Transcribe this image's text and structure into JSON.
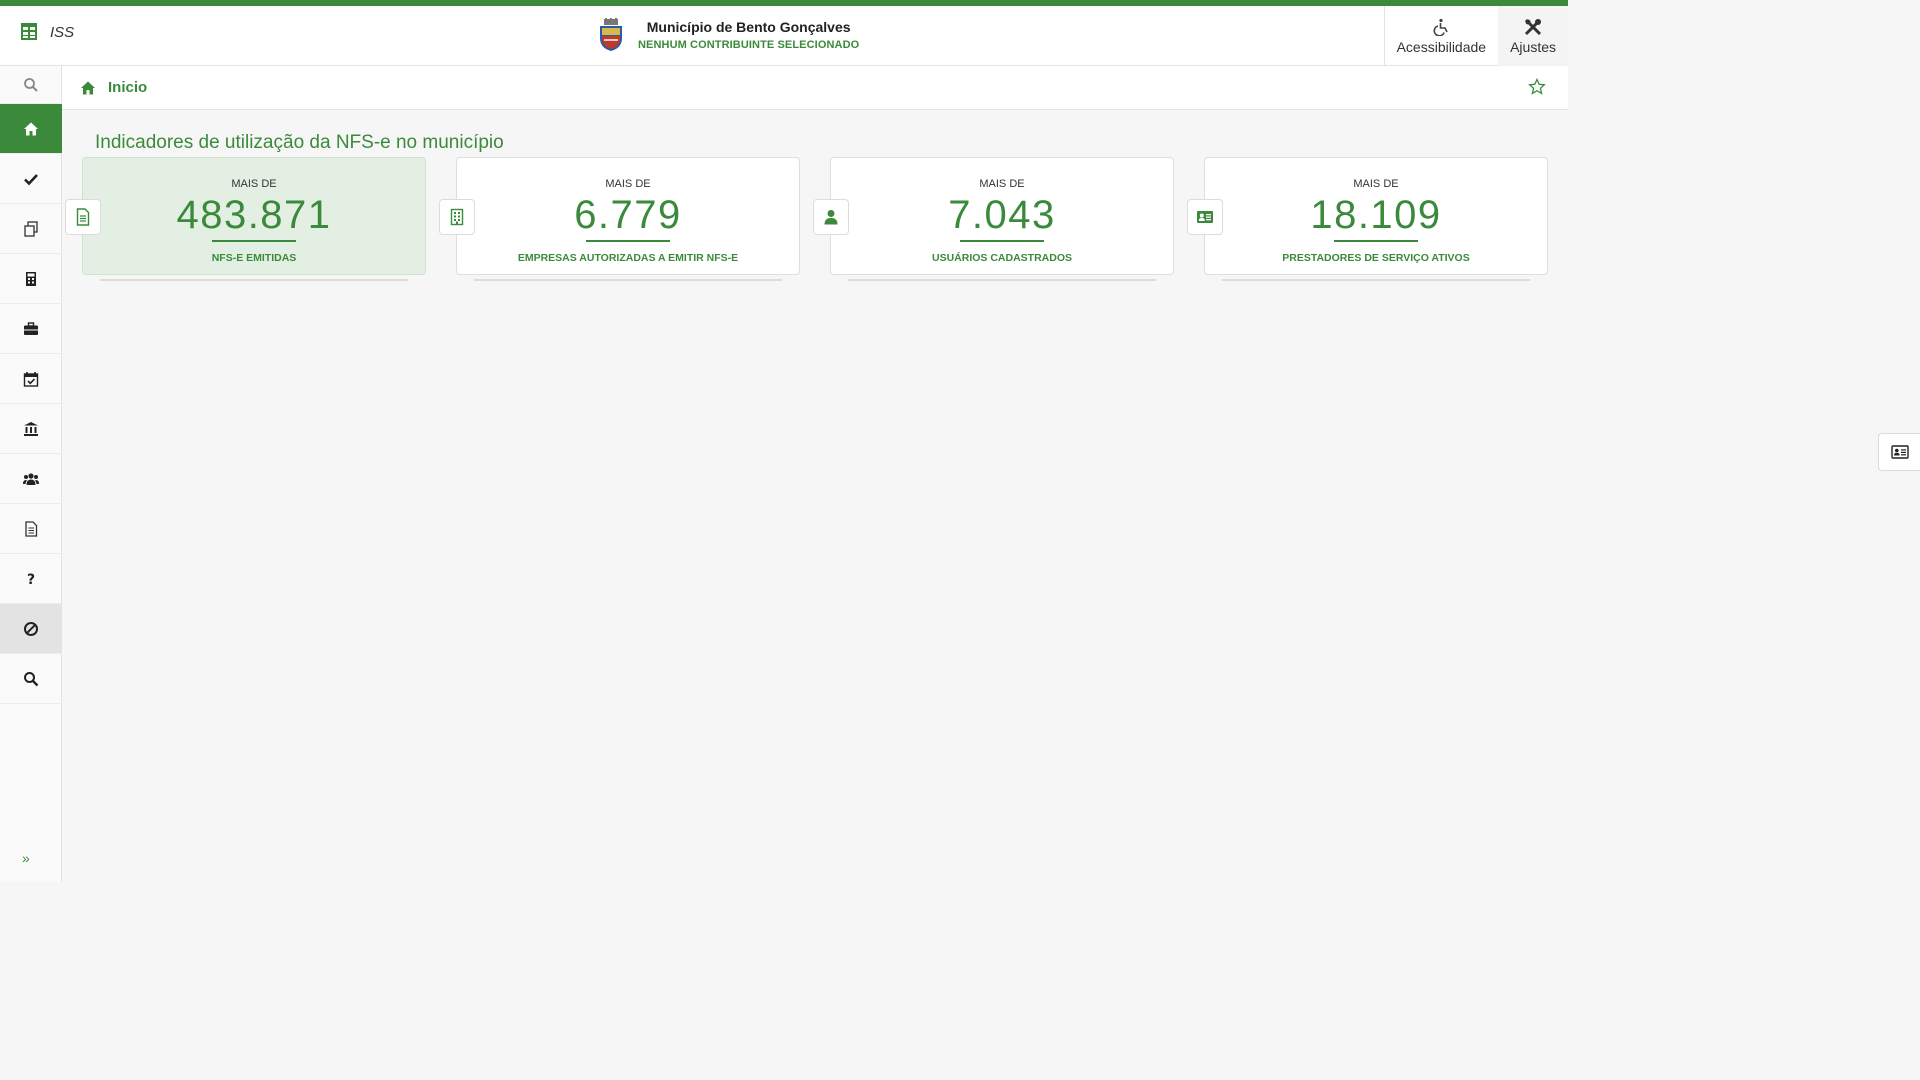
{
  "app": {
    "name": "ISS"
  },
  "header": {
    "municipality": "Município de Bento Gonçalves",
    "taxpayer_status": "NENHUM CONTRIBUINTE SELECIONADO",
    "accessibility_label": "Acessibilidade",
    "settings_label": "Ajustes"
  },
  "breadcrumb": {
    "label": "Inicio"
  },
  "main": {
    "section_title": "Indicadores de utilização da NFS-e no município",
    "cards": [
      {
        "prefix": "MAIS DE",
        "value": "483.871",
        "label": "NFS-E EMITIDAS",
        "icon": "document-icon"
      },
      {
        "prefix": "MAIS DE",
        "value": "6.779",
        "label": "EMPRESAS AUTORIZADAS A EMITIR NFS-E",
        "icon": "building-icon"
      },
      {
        "prefix": "MAIS DE",
        "value": "7.043",
        "label": "USUÁRIOS CADASTRADOS",
        "icon": "user-icon"
      },
      {
        "prefix": "MAIS DE",
        "value": "18.109",
        "label": "PRESTADORES DE SERVIÇO ATIVOS",
        "icon": "id-card-icon"
      }
    ]
  },
  "sidebar": {
    "items": [
      {
        "icon": "search-icon"
      },
      {
        "icon": "home-icon",
        "active": true
      },
      {
        "icon": "check-icon"
      },
      {
        "icon": "documents-icon"
      },
      {
        "icon": "calculator-icon"
      },
      {
        "icon": "briefcase-icon"
      },
      {
        "icon": "calendar-check-icon"
      },
      {
        "icon": "bank-icon"
      },
      {
        "icon": "users-icon"
      },
      {
        "icon": "file-text-icon"
      },
      {
        "icon": "question-icon"
      },
      {
        "icon": "ban-icon"
      },
      {
        "icon": "search-icon"
      }
    ],
    "expand_icon": "double-chevron-right-icon"
  },
  "colors": {
    "brand_green": "#3b8a3b",
    "active_card_bg": "#e3efe3"
  }
}
